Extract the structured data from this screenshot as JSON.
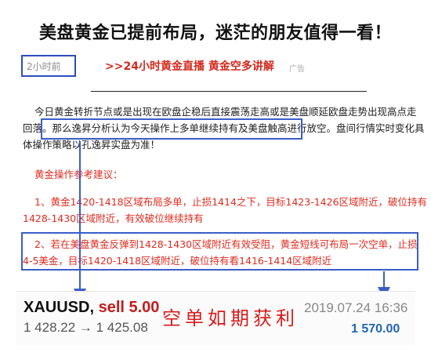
{
  "headline": "美盘黄金已提前布局，迷茫的朋友值得一看！",
  "meta": {
    "time": "2小时前",
    "promo": ">>24小时黄金直播 黄金空多讲解",
    "ad": "广告"
  },
  "article": {
    "line1": "今日黄金转折节点或是出现在欧盘企稳后直接震荡走高或是美盘顺延欧盘走势出现高点走",
    "line2_a": "回落。",
    "line2_hl": "那么逸昇分析认为今天操作上多单继续持有及美盘触高进行放空。",
    "line2_b": "盘间行情实时变化具",
    "line3": "体操作策略以孔逸昇实盘为准！",
    "advice_title": "黄金操作参考建议：",
    "advice1_l1": "1、黄金1420-1418区域布局多单，止损1414之下，目标1423-1426区域附近，破位持有",
    "advice1_l2": "1428-1430区域附近，有效破位继续持有",
    "advice2_l1": "2、若在美盘黄金反弹到1428-1430区域附近有效受阻，黄金短线可布局一次空单，止损",
    "advice2_l2": "4-5美金，目标1420-1418区域附近，破位持有看1416-1414区域附近"
  },
  "trade": {
    "symbol": "XAUUSD,",
    "action": "sell 5.00",
    "range": "1 428.22 → 1 425.08",
    "stamp": "空单如期获利",
    "datetime": "2019.07.24 16:36",
    "profit": "1 570.00"
  },
  "colors": {
    "accent_red": "#e02b1f",
    "box_blue": "#3a5ec9",
    "profit_blue": "#1f66b5"
  }
}
